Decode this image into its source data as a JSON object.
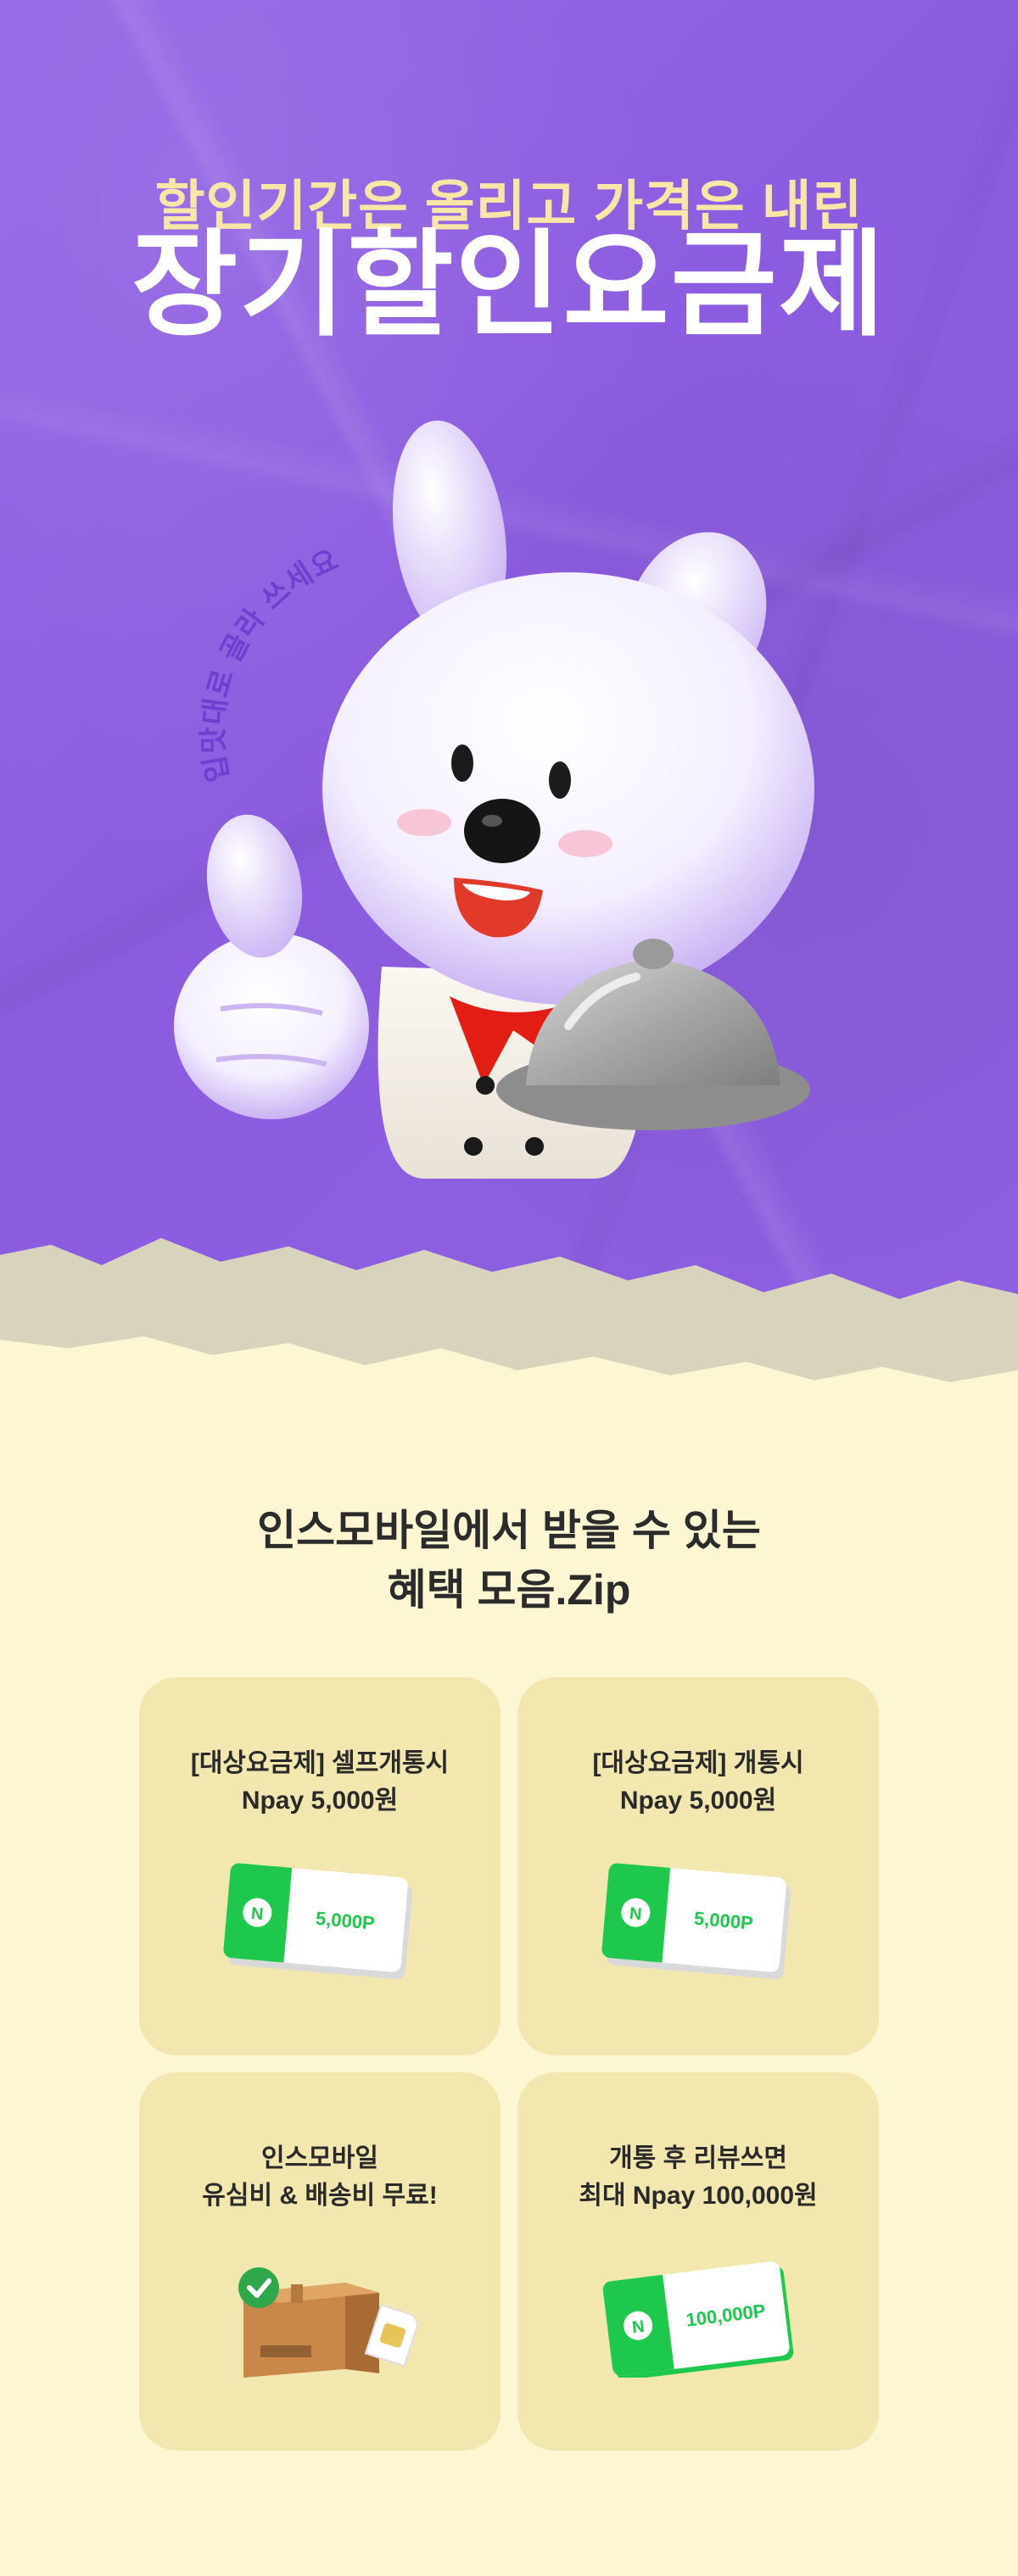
{
  "hero": {
    "subtitle": "할인기간은 올리고 가격은 내린",
    "title": "장기할인요금제",
    "curved_text": "입맛대로 골라 쓰세요"
  },
  "benefits": {
    "heading_line1": "인스모바일에서 받을 수 있는",
    "heading_line2": "혜택 모음.Zip",
    "cards": [
      {
        "line1": "[대상요금제] 셀프개통시",
        "line2": "Npay 5,000원",
        "art_label": "5,000P",
        "badge": "N",
        "art": "npay-card-icon"
      },
      {
        "line1": "[대상요금제] 개통시",
        "line2": "Npay 5,000원",
        "art_label": "5,000P",
        "badge": "N",
        "art": "npay-card-icon"
      },
      {
        "line1": "인스모바일",
        "line2": "유심비 & 배송비 무료!",
        "art": "box-and-sim-icon"
      },
      {
        "line1": "개통 후 리뷰쓰면",
        "line2": "최대 Npay 100,000원",
        "art_label": "100,000P",
        "badge": "N",
        "art": "npay-card-icon"
      }
    ]
  },
  "colors": {
    "hero_purple": "#8b5cdf",
    "cream": "#fdf6d3",
    "card": "#f3e7b0",
    "npay_green": "#1ec84c",
    "title_yellow": "#f8e6a6"
  }
}
